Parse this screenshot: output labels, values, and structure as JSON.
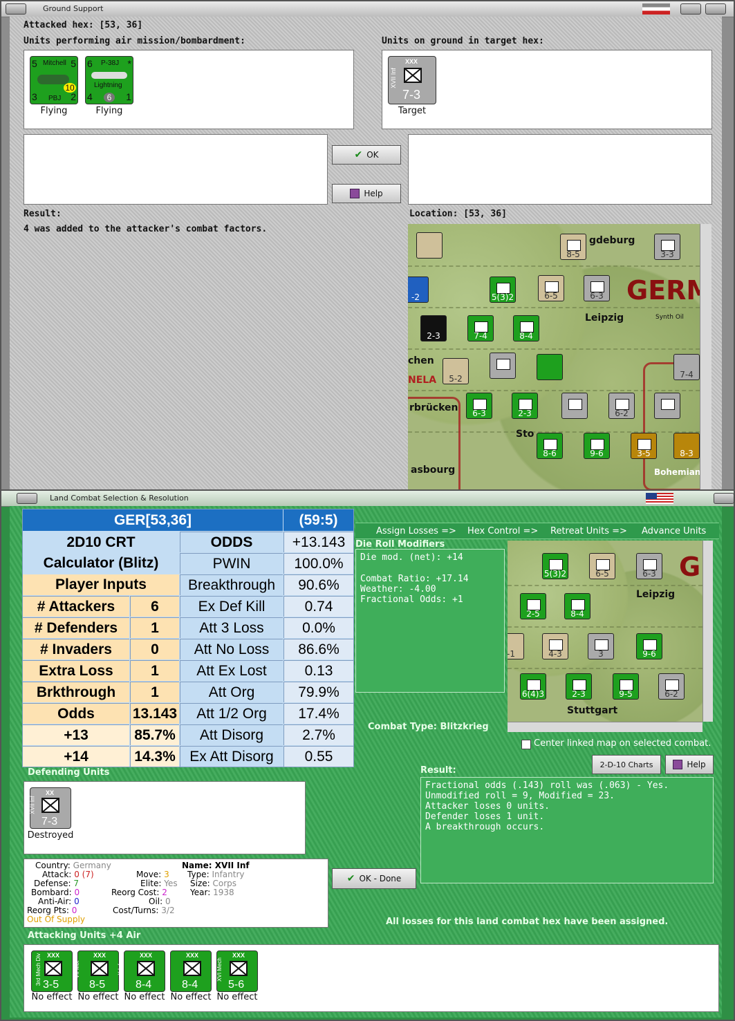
{
  "ground_support": {
    "title": "Ground Support",
    "attacked_hex_label": "Attacked hex:",
    "attacked_hex": "[53, 36]",
    "air_units_label": "Units performing air mission/bombardment:",
    "ground_units_label": "Units on ground in target hex:",
    "air_units": [
      {
        "name": "Mitchell",
        "sub": "PBJ",
        "tl": "5",
        "tr": "5",
        "bl": "3",
        "br": "2",
        "mid": "10",
        "status": "Flying"
      },
      {
        "name": "P-38J",
        "sub": "Lightning",
        "tl": "6",
        "tr": "*",
        "bl": "4",
        "br": "1",
        "mid": "6",
        "status": "Flying"
      }
    ],
    "target_unit": {
      "size": "XXX",
      "side": "XVII Inf",
      "value": "7-3",
      "status": "Target"
    },
    "ok_label": "OK",
    "help_label": "Help",
    "result_label": "Result:",
    "result_text": "4 was added to the attacker's combat factors.",
    "location_label": "Location:",
    "location": "[53, 36]"
  },
  "map1": {
    "cities": [
      "gdeburg",
      "GERM",
      "Leipzig",
      "Synth Oil",
      "chen",
      "NELA",
      "rbrücken",
      "Sto",
      "asbourg",
      "Bohemian"
    ],
    "counters": [
      "8-5",
      "3-3",
      "5(3)2",
      "6-5",
      "6-3",
      "7-4",
      "8-4",
      "2-3",
      "5-2",
      "6-3",
      "2-3",
      "6-2",
      "8-6",
      "9-6",
      "3-5",
      "8-3",
      "7-4",
      "-2"
    ]
  },
  "land_combat": {
    "title": "Land Combat Selection & Resolution",
    "crt": {
      "header_left": "GER[53,36]",
      "header_right": "(59:5)",
      "calc_title": "2D10 CRT Calculator (Blitz)",
      "player_inputs": "Player Inputs",
      "inputs": [
        {
          "label": "# Attackers",
          "value": "6"
        },
        {
          "label": "# Defenders",
          "value": "1"
        },
        {
          "label": "# Invaders",
          "value": "0"
        },
        {
          "label": "Extra Loss",
          "value": "1"
        },
        {
          "label": "Brkthrough",
          "value": "1"
        },
        {
          "label": "Odds",
          "value": "13.143"
        },
        {
          "label": "+13",
          "value": "85.7%"
        },
        {
          "label": "+14",
          "value": "14.3%"
        }
      ],
      "results": [
        {
          "label": "ODDS",
          "value": "+13.143"
        },
        {
          "label": "PWIN",
          "value": "100.0%"
        },
        {
          "label": "Breakthrough",
          "value": "90.6%"
        },
        {
          "label": "Ex Def Kill",
          "value": "0.74"
        },
        {
          "label": "Att 3 Loss",
          "value": "0.0%"
        },
        {
          "label": "Att No Loss",
          "value": "86.6%"
        },
        {
          "label": "Att Ex Lost",
          "value": "0.13"
        },
        {
          "label": "Att Org",
          "value": "79.9%"
        },
        {
          "label": "Att 1/2 Org",
          "value": "17.4%"
        },
        {
          "label": "Att Disorg",
          "value": "2.7%"
        },
        {
          "label": "Ex Att Disorg",
          "value": "0.55"
        }
      ]
    },
    "steps": [
      "Assign Losses =>",
      "Hex Control =>",
      "Retreat Units =>",
      "Advance Units"
    ],
    "die_roll_label": "Die Roll Modifiers",
    "die_roll_lines": [
      "Die mod. (net): +14",
      "",
      "Combat Ratio: +17.14",
      "Weather: -4.00",
      "Fractional Odds: +1"
    ],
    "combat_type_label": "Combat Type:",
    "combat_type": "Blitzkrieg",
    "center_map_label": "Center linked map on selected combat.",
    "charts_label": "2-D-10 Charts",
    "help_label": "Help",
    "result_label": "Result:",
    "result_lines": [
      "Fractional odds (.143) roll was (.063)  - Yes.",
      "Unmodified roll = 9, Modified = 23.",
      "Attacker loses 0 units.",
      "Defender loses 1 unit.",
      "A breakthrough occurs."
    ],
    "ok_done_label": "OK - Done",
    "losses_assigned": "All losses for this land combat hex have been assigned.",
    "defending_label": "Defending Units",
    "defender": {
      "size": "XX",
      "side": "XVII Inf",
      "value": "7-3",
      "status": "Destroyed"
    },
    "info": {
      "country_label": "Country:",
      "country": "Germany",
      "attack_label": "Attack:",
      "attack": "0",
      "attack_extra": "(7)",
      "defense_label": "Defense:",
      "defense": "7",
      "bombard_label": "Bombard:",
      "bombard": "0",
      "antiair_label": "Anti-Air:",
      "antiair": "0",
      "reorg_pts_label": "Reorg Pts:",
      "reorg_pts": "0",
      "supply": "Out Of Supply",
      "move_label": "Move:",
      "move": "3",
      "elite_label": "Elite:",
      "elite": "Yes",
      "reorg_cost_label": "Reorg Cost:",
      "reorg_cost": "2",
      "oil_label": "Oil:",
      "oil": "0",
      "cost_turns_label": "Cost/Turns:",
      "cost_turns": "3/2",
      "name_label": "Name:",
      "name": "XVII Inf",
      "type_label": "Type:",
      "type": "Infantry",
      "size_label": "Size:",
      "size": "Corps",
      "year_label": "Year:",
      "year": "1938"
    },
    "attacking_label": "Attacking Units +4 Air",
    "attackers": [
      {
        "side": "3rd Mech Div",
        "value": "3-5",
        "status": "No effect"
      },
      {
        "side": "VII Mot",
        "value": "8-5",
        "status": "No effect"
      },
      {
        "side": "X Inf",
        "value": "8-4",
        "status": "No effect"
      },
      {
        "side": "V Mot",
        "value": "8-4",
        "status": "No effect"
      },
      {
        "side": "XVI Mech",
        "value": "5-6",
        "status": "No effect"
      }
    ],
    "map2_cities": [
      "G",
      "Leipzig",
      "Stuttgart"
    ],
    "map2_counters": [
      "5(3)2",
      "6-5",
      "6-3",
      "2-5",
      "8-4",
      "4-3",
      "3",
      "9-6",
      "6(4)3",
      "2-3",
      "9-5",
      "6-2",
      "-1"
    ]
  }
}
